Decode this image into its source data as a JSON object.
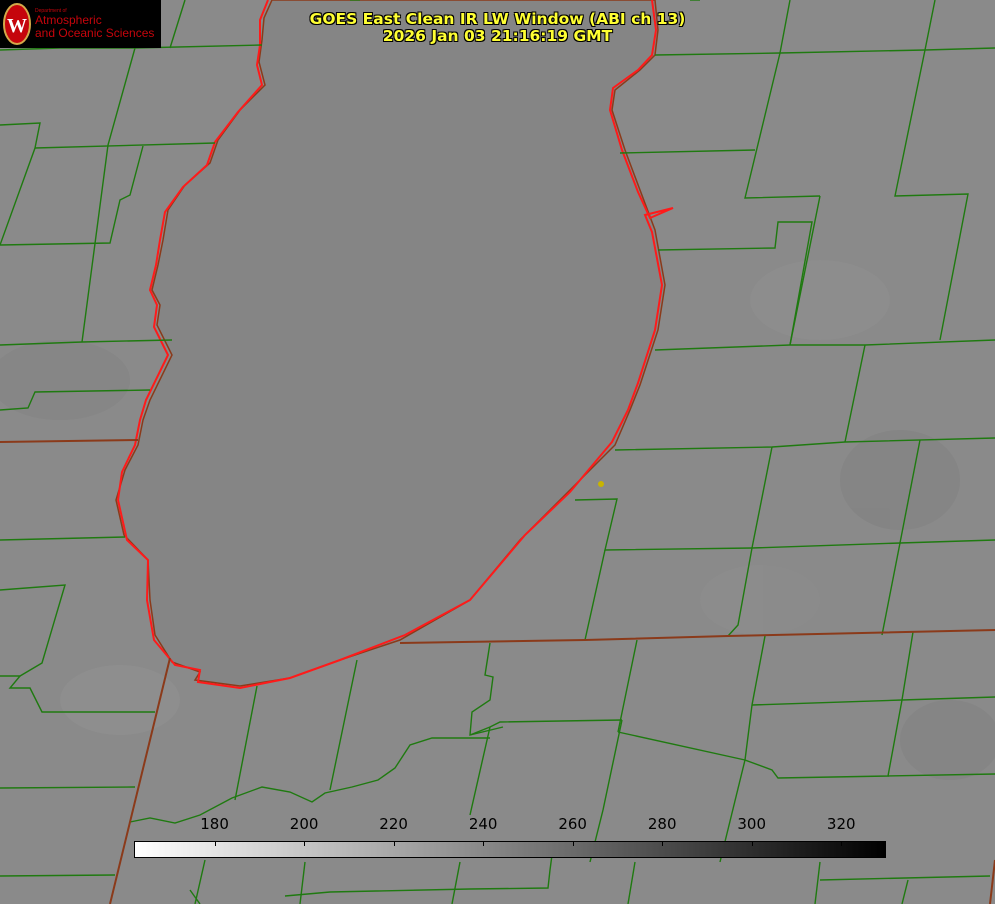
{
  "title": {
    "line1": "GOES East Clean IR LW Window (ABI ch 13)",
    "line2": "2026 Jan 03 21:16:19 GMT"
  },
  "logo": {
    "department": "Department of",
    "line1": "Atmospheric",
    "line2": "and Oceanic Sciences",
    "crest_letter": "W"
  },
  "colorbar": {
    "ticks": [
      "180",
      "200",
      "220",
      "240",
      "260",
      "280",
      "300",
      "320"
    ],
    "min_value": 162,
    "max_value": 330,
    "gradient_start": "#ffffff",
    "gradient_end": "#000000"
  },
  "colors": {
    "background": "#8a8a8a",
    "lake": "#858585",
    "county_lines": "#1f7a10",
    "state_lines": "#8b3a1a",
    "lake_outline": "#ff1a1a",
    "title_text": "#ffff33",
    "marker": "#c8b400"
  }
}
